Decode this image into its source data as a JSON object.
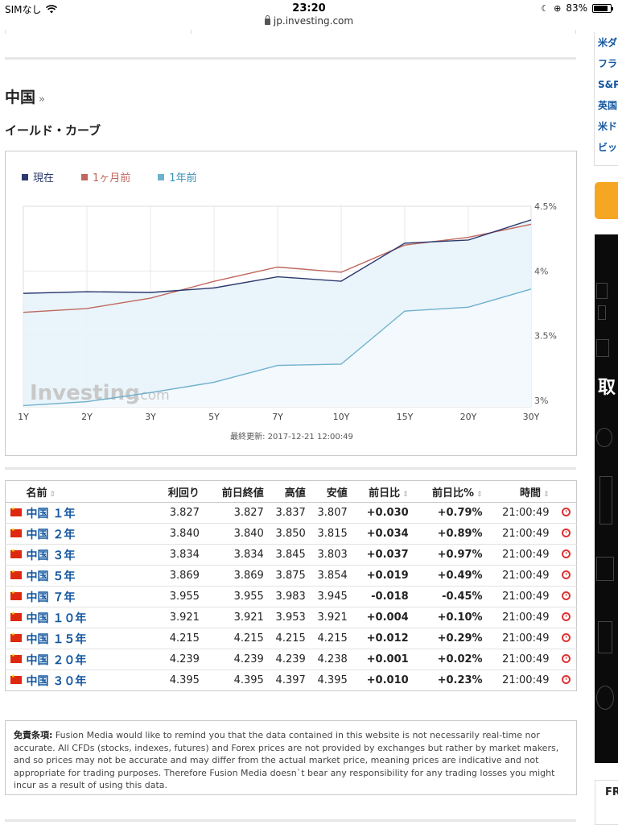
{
  "status_bar": {
    "carrier": "SIMなし",
    "time": "23:20",
    "battery": "83%"
  },
  "url": "jp.investing.com",
  "section_title": "中国",
  "section_arrow": "»",
  "subtitle": "イールド・カーブ",
  "chart_data": {
    "type": "line",
    "legend": [
      "現在",
      "1ヶ月前",
      "1年前"
    ],
    "categories": [
      "1Y",
      "2Y",
      "3Y",
      "5Y",
      "7Y",
      "10Y",
      "15Y",
      "20Y",
      "30Y"
    ],
    "y_ticks": [
      "4.5%",
      "4%",
      "3.5%",
      "3%"
    ],
    "ylim": [
      2.95,
      4.5
    ],
    "series": [
      {
        "name": "現在",
        "color": "#2b3a6e",
        "values": [
          3.827,
          3.84,
          3.834,
          3.869,
          3.955,
          3.921,
          4.215,
          4.239,
          4.395
        ]
      },
      {
        "name": "1ヶ月前",
        "color": "#c0675e",
        "values": [
          3.68,
          3.71,
          3.79,
          3.92,
          4.03,
          3.99,
          4.2,
          4.26,
          4.36
        ]
      },
      {
        "name": "1年前",
        "color": "#6fb0cc",
        "values": [
          2.96,
          2.99,
          3.06,
          3.14,
          3.27,
          3.28,
          3.69,
          3.72,
          3.86
        ]
      }
    ],
    "watermark": "Investing",
    "watermark_suffix": ".com",
    "updated": "最終更新: 2017-12-21 12:00:49"
  },
  "table": {
    "headers": [
      "名前",
      "利回り",
      "前日終値",
      "高値",
      "安値",
      "前日比",
      "前日比%",
      "時間"
    ],
    "rows": [
      {
        "name": "中国 １年",
        "yield": "3.827",
        "prev": "3.827",
        "high": "3.837",
        "low": "3.807",
        "chg": "+0.030",
        "chg_pct": "+0.79%",
        "time": "21:00:49",
        "dir": "pos"
      },
      {
        "name": "中国 ２年",
        "yield": "3.840",
        "prev": "3.840",
        "high": "3.850",
        "low": "3.815",
        "chg": "+0.034",
        "chg_pct": "+0.89%",
        "time": "21:00:49",
        "dir": "pos"
      },
      {
        "name": "中国 ３年",
        "yield": "3.834",
        "prev": "3.834",
        "high": "3.845",
        "low": "3.803",
        "chg": "+0.037",
        "chg_pct": "+0.97%",
        "time": "21:00:49",
        "dir": "pos"
      },
      {
        "name": "中国 ５年",
        "yield": "3.869",
        "prev": "3.869",
        "high": "3.875",
        "low": "3.854",
        "chg": "+0.019",
        "chg_pct": "+0.49%",
        "time": "21:00:49",
        "dir": "pos"
      },
      {
        "name": "中国 ７年",
        "yield": "3.955",
        "prev": "3.955",
        "high": "3.983",
        "low": "3.945",
        "chg": "-0.018",
        "chg_pct": "-0.45%",
        "time": "21:00:49",
        "dir": "neg"
      },
      {
        "name": "中国 １０年",
        "yield": "3.921",
        "prev": "3.921",
        "high": "3.953",
        "low": "3.921",
        "chg": "+0.004",
        "chg_pct": "+0.10%",
        "time": "21:00:49",
        "dir": "pos"
      },
      {
        "name": "中国 １５年",
        "yield": "4.215",
        "prev": "4.215",
        "high": "4.215",
        "low": "4.215",
        "chg": "+0.012",
        "chg_pct": "+0.29%",
        "time": "21:00:49",
        "dir": "pos"
      },
      {
        "name": "中国 ２０年",
        "yield": "4.239",
        "prev": "4.239",
        "high": "4.239",
        "low": "4.238",
        "chg": "+0.001",
        "chg_pct": "+0.02%",
        "time": "21:00:49",
        "dir": "pos"
      },
      {
        "name": "中国 ３０年",
        "yield": "4.395",
        "prev": "4.395",
        "high": "4.397",
        "low": "4.395",
        "chg": "+0.010",
        "chg_pct": "+0.23%",
        "time": "21:00:49",
        "dir": "pos"
      }
    ]
  },
  "disclaimer": {
    "label": "免責条項:",
    "text": " Fusion Media would like to remind you that the data contained in this website is not necessarily real-time nor accurate. All CFDs (stocks, indexes, futures) and Forex prices are not provided by exchanges but rather by market makers, and so prices may not be accurate and may differ from the actual market price, meaning prices are indicative and not appropriate for trading purposes. Therefore Fusion Media doesn`t bear any responsibility for any trading losses you might incur as a result of using this data."
  },
  "sidebar": {
    "items": [
      "米ダ",
      "フラ",
      "S&P",
      "英国",
      "米ド",
      "ビッ"
    ],
    "dark_char": "取",
    "bottom_label": "FR"
  }
}
